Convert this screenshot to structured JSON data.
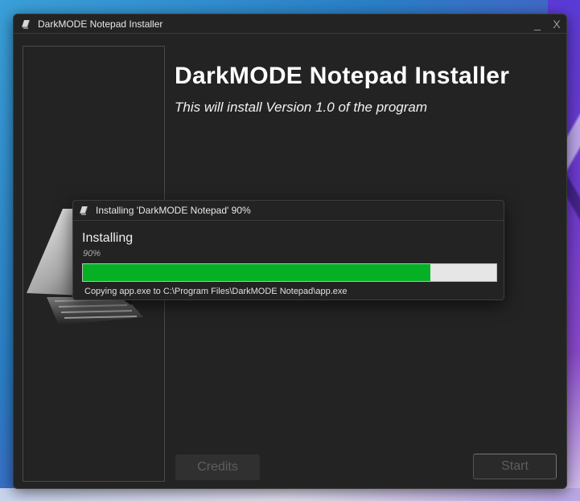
{
  "window": {
    "title": "DarkMODE Notepad Installer",
    "minimize_glyph": "_",
    "close_glyph": "X"
  },
  "main": {
    "heading": "DarkMODE Notepad Installer",
    "subheading": "This will install Version 1.0 of the program",
    "credits_label": "Credits",
    "start_label": "Start"
  },
  "dialog": {
    "title": "Installing 'DarkMODE Notepad' 90%",
    "label": "Installing",
    "percent_text": "90%",
    "progress": 0.84,
    "status": "Copying app.exe to C:\\Program Files\\DarkMODE Notepad\\app.exe"
  },
  "colors": {
    "window_bg": "#232323",
    "progress_fill": "#06b025",
    "progress_track": "#e6e6e6"
  },
  "icons": [
    "notepad-app-icon",
    "notepad-logo-icon"
  ]
}
